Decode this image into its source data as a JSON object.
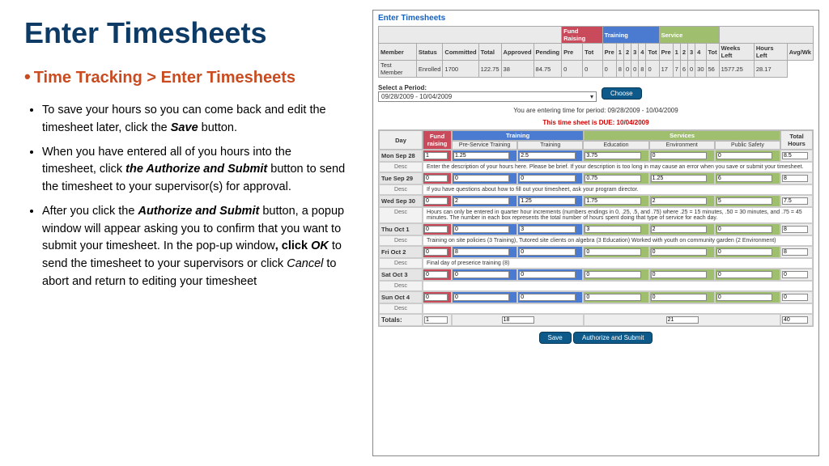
{
  "title": "Enter Timesheets",
  "breadcrumb": "Time Tracking > Enter Timesheets",
  "bullets": [
    "To save your hours so you can come back and edit the timesheet later, click the ",
    "When you have entered all of you hours into the timesheet, click ",
    "After you click the "
  ],
  "bullet_tails": [
    " button.",
    " button to send the timesheet to your supervisor(s) for approval.",
    " button, a popup window will appear asking you to confirm that you want to submit your timesheet. In the pop-up window"
  ],
  "bold_terms": [
    "Save",
    "the Authorize and Submit",
    "Authorize and Submit"
  ],
  "bullet3_mid": ", click ",
  "bullet3_ok": "OK",
  "bullet3_tail2": " to send the timesheet to your supervisors or click ",
  "bullet3_cancel": "Cancel",
  "bullet3_tail3": " to abort and return to editing your timesheet",
  "panel": {
    "title": "Enter Timesheets",
    "summary_groups": {
      "fr": "Fund Raising",
      "tr": "Training",
      "sv": "Service"
    },
    "summary_headers": [
      "Member",
      "Status",
      "Committed",
      "Total",
      "Approved",
      "Pending",
      "Pre",
      "Tot",
      "Pre",
      "1",
      "2",
      "3",
      "4",
      "Tot",
      "Pre",
      "1",
      "2",
      "3",
      "4",
      "Tot",
      "Weeks Left",
      "Hours Left",
      "Avg/Wk"
    ],
    "summary_row": [
      "Test Member",
      "Enrolled",
      "1700",
      "122.75",
      "38",
      "84.75",
      "0",
      "0",
      "0",
      "8",
      "0",
      "0",
      "8",
      "0",
      "17",
      "7",
      "6",
      "0",
      "30",
      "56",
      "1577.25",
      "28.17"
    ],
    "period_label": "Select a Period:",
    "period_value": "09/28/2009 - 10/04/2009",
    "choose": "Choose",
    "entering": "You are entering time for period: 09/28/2009 - 10/04/2009",
    "due": "This time sheet is DUE: 10/04/2009",
    "cat_training": "Training",
    "cat_services": "Services",
    "col_day": "Day",
    "col_fr": "Fund raising",
    "col_total": "Total Hours",
    "subcols": [
      "Pre-Service Training",
      "Training",
      "Education",
      "Environment",
      "Public Safety"
    ],
    "days": [
      {
        "label": "Mon Sep 28",
        "fr": "1",
        "vals": [
          "1.25",
          "2.5",
          "3.75",
          "0",
          "0"
        ],
        "total": "8.5",
        "desc": "Enter the description of your hours here. Please be brief. If your description is too long in may cause an error when you save or submit your timesheet."
      },
      {
        "label": "Tue Sep 29",
        "fr": "0",
        "vals": [
          "0",
          "0",
          "0.75",
          "1.25",
          "6"
        ],
        "total": "8",
        "desc": "If you have questions about how to fill out your timesheet, ask your program director."
      },
      {
        "label": "Wed Sep 30",
        "fr": "0",
        "vals": [
          "2",
          "1.25",
          "1.75",
          "2",
          "5"
        ],
        "total": "7.5",
        "desc": "Hours can only be entered in quarter hour increments (numbers endings in 0, .25, .5, and .75) where .25 = 15 minutes, .50 = 30 minutes, and .75 = 45 minutes. The number in each box represents the total number of hours spent doing that type of service for each day."
      },
      {
        "label": "Thu Oct 1",
        "fr": "0",
        "vals": [
          "0",
          "3",
          "3",
          "2",
          "0"
        ],
        "total": "8",
        "desc": "Training on site policies (3 Training), Tutored site clients on algebra (3 Education) Worked with youth on community garden (2 Environment)"
      },
      {
        "label": "Fri Oct 2",
        "fr": "0",
        "vals": [
          "8",
          "0",
          "0",
          "0",
          "0"
        ],
        "total": "8",
        "desc": "Final day of preserice training (8)"
      },
      {
        "label": "Sat Oct 3",
        "fr": "0",
        "vals": [
          "0",
          "0",
          "0",
          "0",
          "0"
        ],
        "total": "0",
        "desc": ""
      },
      {
        "label": "Sun Oct 4",
        "fr": "0",
        "vals": [
          "0",
          "0",
          "0",
          "0",
          "0"
        ],
        "total": "0",
        "desc": ""
      }
    ],
    "totals_label": "Totals:",
    "totals": {
      "fr": "1",
      "training": "18",
      "services": "21",
      "grand": "40"
    },
    "save": "Save",
    "submit": "Authorize and Submit",
    "desc_label": "Desc"
  }
}
